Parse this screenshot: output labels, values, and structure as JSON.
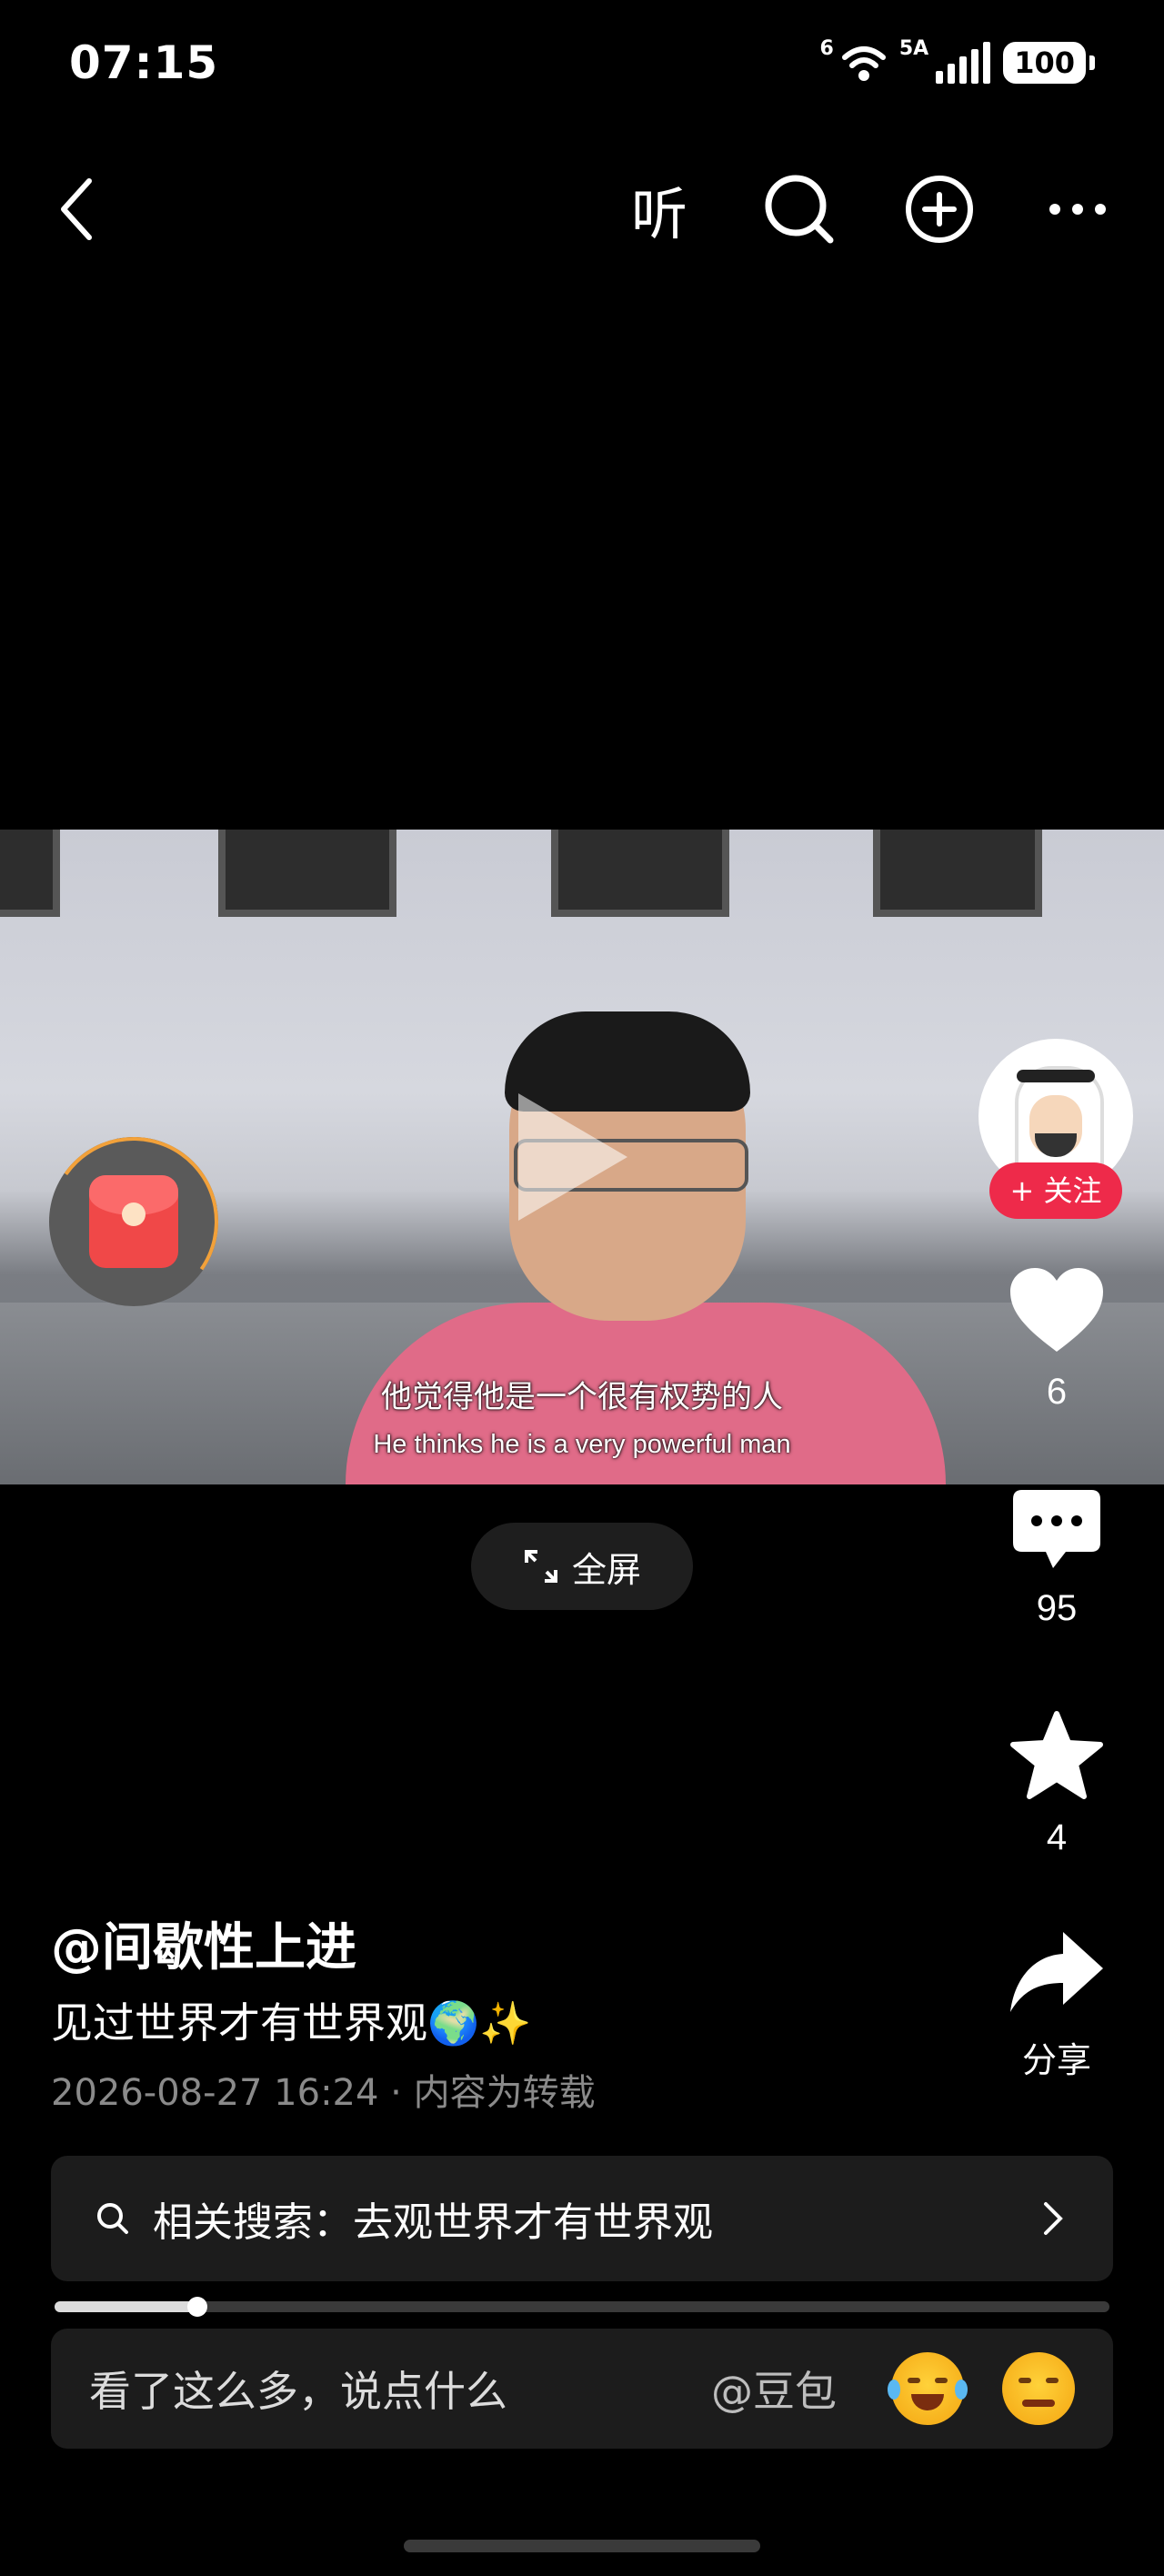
{
  "status_bar": {
    "time": "07:15",
    "network_wifi": "6",
    "network_cell": "5A",
    "battery": "100"
  },
  "top_bar": {
    "listen_label": "听"
  },
  "video": {
    "subtitle_cn": "他觉得他是一个很有权势的人",
    "subtitle_en": "He thinks he is a very powerful man",
    "fullscreen_label": "全屏"
  },
  "right_rail": {
    "follow_label": "+ 关注",
    "likes": "6",
    "comments": "95",
    "favorites": "4",
    "share_label": "分享"
  },
  "post": {
    "author": "@间歇性上进",
    "description": "见过世界才有世界观🌍✨",
    "meta": "2026-08-27 16:24 · 内容为转载"
  },
  "related_search": {
    "text": "相关搜索：去观世界才有世界观"
  },
  "progress": {
    "fraction": 0.135
  },
  "comment_bar": {
    "placeholder": "看了这么多，说点什么",
    "mention": "@豆包"
  },
  "icons": [
    "back-icon",
    "search-icon",
    "add-circle-icon",
    "more-icon",
    "heart-icon",
    "comment-icon",
    "star-icon",
    "share-icon",
    "fullscreen-icon",
    "red-envelope-icon"
  ],
  "colors": {
    "follow_red": "#ee2a4a",
    "envelope_red": "#f04848",
    "progress_orange": "#f2a13a"
  }
}
